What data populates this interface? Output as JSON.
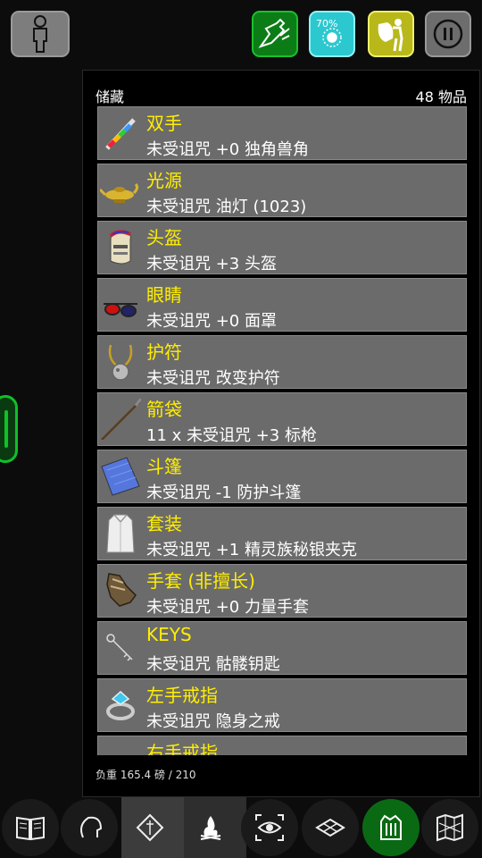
{
  "light_button": {
    "percent_label": "70%"
  },
  "inventory": {
    "title": "储藏",
    "count": "48 物品",
    "slots": [
      {
        "category": "双手",
        "item": "未受诅咒 +0 独角兽角",
        "icon": "unicorn-horn-icon"
      },
      {
        "category": "光源",
        "item": "未受诅咒 油灯 (1023)",
        "icon": "oil-lamp-icon"
      },
      {
        "category": "头盔",
        "item": "未受诅咒 +3 头盔",
        "icon": "helmet-icon"
      },
      {
        "category": "眼睛",
        "item": "未受诅咒 +0 面罩",
        "icon": "glasses-icon"
      },
      {
        "category": "护符",
        "item": "未受诅咒 改变护符",
        "icon": "amulet-icon"
      },
      {
        "category": "箭袋",
        "item": "11 x 未受诅咒 +3 标枪",
        "icon": "javelin-icon"
      },
      {
        "category": "斗篷",
        "item": "未受诅咒 -1 防护斗篷",
        "icon": "cloak-icon"
      },
      {
        "category": "套装",
        "item": "未受诅咒 +1 精灵族秘银夹克",
        "icon": "mithril-coat-icon"
      },
      {
        "category": "手套 (非擅长)",
        "item": "未受诅咒 +0 力量手套",
        "icon": "gauntlets-icon"
      },
      {
        "category": "KEYS",
        "item": "未受诅咒 骷髅钥匙",
        "icon": "key-icon"
      },
      {
        "category": "左手戒指",
        "item": "未受诅咒 隐身之戒",
        "icon": "ring-icon"
      },
      {
        "category": "右手戒指",
        "item": "",
        "icon": "ring-icon"
      }
    ],
    "weight": "负重 165.4 磅 / 210"
  },
  "colors": {
    "category_text": "#ffee00",
    "slot_bg": "#6b6b6b",
    "accent_green": "#0fc02a"
  }
}
